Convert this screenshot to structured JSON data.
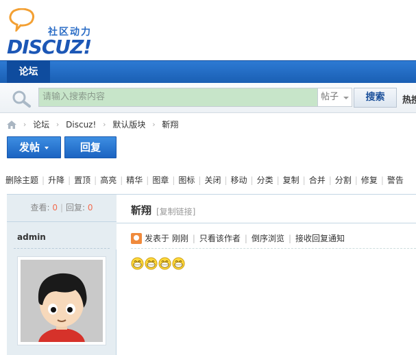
{
  "header": {
    "logo_tagline": "社区动力",
    "logo_text": "DISCUZ!"
  },
  "nav": {
    "tabs": [
      {
        "label": "论坛"
      }
    ]
  },
  "search": {
    "placeholder": "请输入搜索内容",
    "type_value": "帖子",
    "button_label": "搜索",
    "hot_label": "热搜"
  },
  "breadcrumb": {
    "items": [
      "论坛",
      "Discuz!",
      "默认版块",
      "靳翔"
    ]
  },
  "actions": {
    "post_label": "发帖",
    "reply_label": "回复"
  },
  "mod_tools": [
    "删除主题",
    "升降",
    "置顶",
    "高亮",
    "精华",
    "图章",
    "图标",
    "关闭",
    "移动",
    "分类",
    "复制",
    "合并",
    "分割",
    "修复",
    "警告"
  ],
  "thread": {
    "views_label": "查看:",
    "views": "0",
    "replies_label": "回复:",
    "replies": "0",
    "title": "靳翔",
    "copy_link": "[复制链接]"
  },
  "post": {
    "author": "admin",
    "posted_label": "发表于 刚刚",
    "only_author": "只看该作者",
    "reverse": "倒序浏览",
    "notify": "接收回复通知",
    "emoticon_count": 4
  },
  "colors": {
    "nav_blue": "#1a5fb4",
    "accent_orange": "#f26c4f",
    "search_bg": "#c7e5c9"
  }
}
